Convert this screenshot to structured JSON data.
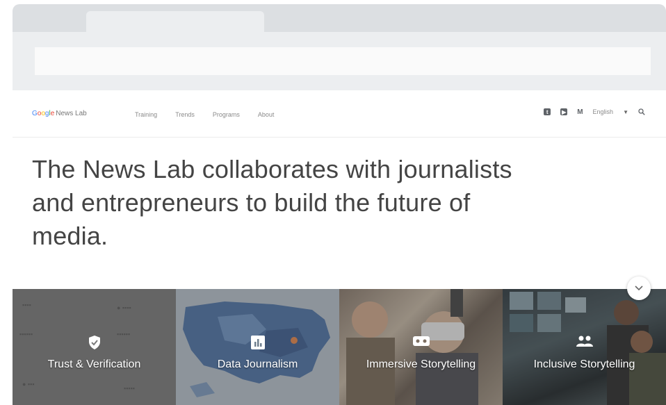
{
  "nav": {
    "logo_google": "Google",
    "logo_product": "News Lab",
    "links": [
      "Training",
      "Trends",
      "Programs",
      "About"
    ],
    "language": "English",
    "icons": [
      "tumblr-icon",
      "youtube-icon",
      "medium-icon"
    ]
  },
  "hero": {
    "headline": "The News Lab collaborates with journalists and entrepreneurs to build the future of media."
  },
  "tiles": [
    {
      "label": "Trust & Verification",
      "icon": "shield-check-icon"
    },
    {
      "label": "Data Journalism",
      "icon": "bar-chart-icon"
    },
    {
      "label": "Immersive Storytelling",
      "icon": "vr-headset-icon"
    },
    {
      "label": "Inclusive Storytelling",
      "icon": "people-icon"
    }
  ],
  "colors": {
    "chrome": "#dcdfe2",
    "toolbar": "#eceef0",
    "text": "#444444"
  }
}
